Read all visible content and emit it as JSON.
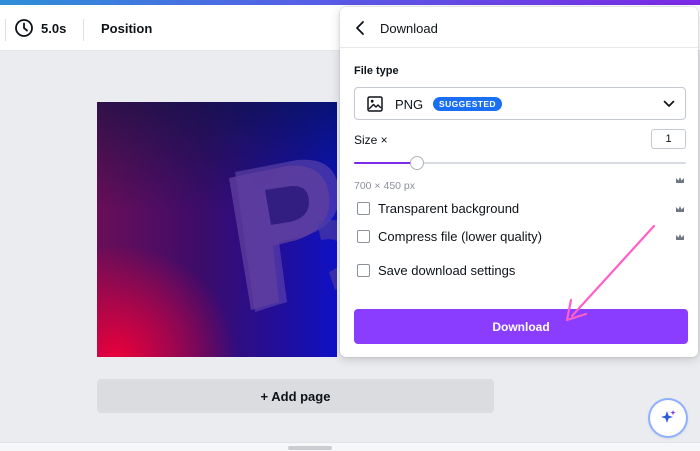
{
  "toolbar": {
    "duration": "5.0s",
    "position_label": "Position"
  },
  "canvas": {
    "add_page_label": "+ Add page"
  },
  "download_panel": {
    "title": "Download",
    "file_type_label": "File type",
    "file_type_value": "PNG",
    "file_type_badge": "SUGGESTED",
    "size_label": "Size ×",
    "size_value": "1",
    "size_slider_fraction": 0.19,
    "dimensions": "700 × 450 px",
    "options": [
      {
        "label": "Transparent background",
        "checked": false,
        "premium": true
      },
      {
        "label": "Compress file (lower quality)",
        "checked": false,
        "premium": true
      },
      {
        "label": "Save download settings",
        "checked": false,
        "premium": false
      }
    ],
    "download_button": "Download"
  },
  "colors": {
    "accent": "#8b3dff",
    "badge": "#1a6ff5",
    "arrow": "#ff5fc8",
    "premium_crown": "#6f7785"
  },
  "icons": [
    "clock-icon",
    "back-arrow-icon",
    "image-icon",
    "chevron-down-icon",
    "crown-icon",
    "magic-sparkle-icon"
  ]
}
